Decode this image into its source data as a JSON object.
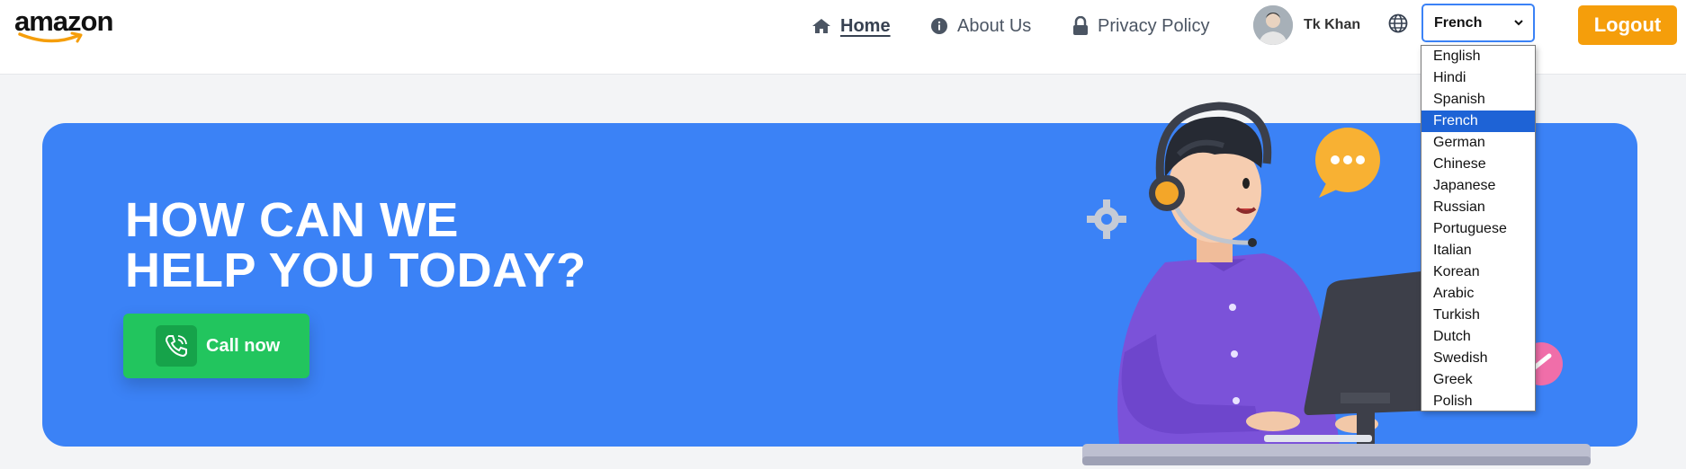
{
  "brand": {
    "logo_text": "amazon"
  },
  "nav": {
    "home": "Home",
    "about": "About Us",
    "privacy": "Privacy Policy"
  },
  "user": {
    "name": "Tk Khan"
  },
  "language": {
    "selected": "French",
    "options": [
      "English",
      "Hindi",
      "Spanish",
      "French",
      "German",
      "Chinese",
      "Japanese",
      "Russian",
      "Portuguese",
      "Italian",
      "Korean",
      "Arabic",
      "Turkish",
      "Dutch",
      "Swedish",
      "Greek",
      "Polish"
    ]
  },
  "actions": {
    "logout": "Logout"
  },
  "hero": {
    "title_line1": "HOW CAN WE",
    "title_line2": "HELP YOU TODAY?",
    "call_label": "Call now"
  },
  "colors": {
    "hero_bg": "#3b82f6",
    "logout_bg": "#f59e0b",
    "call_bg": "#22c55e",
    "dropdown_selected": "#1e63d6"
  },
  "icons": [
    "home-icon",
    "info-icon",
    "lock-icon",
    "avatar",
    "globe-icon",
    "chevron-down-icon",
    "phone-icon"
  ]
}
